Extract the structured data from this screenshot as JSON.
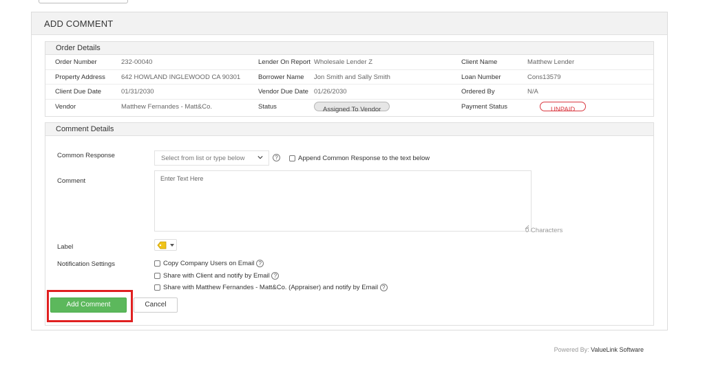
{
  "panel": {
    "title": "ADD COMMENT"
  },
  "order_details": {
    "title": "Order Details",
    "rows": [
      [
        {
          "label": "Order Number",
          "value": "232-00040"
        },
        {
          "label": "Lender On Report",
          "value": "Wholesale Lender Z"
        },
        {
          "label": "Client Name",
          "value": "Matthew Lender"
        }
      ],
      [
        {
          "label": "Property Address",
          "value": "642 HOWLAND INGLEWOOD CA 90301"
        },
        {
          "label": "Borrower Name",
          "value": "Jon Smith and Sally Smith"
        },
        {
          "label": "Loan Number",
          "value": "Cons13579"
        }
      ],
      [
        {
          "label": "Client Due Date",
          "value": "01/31/2030"
        },
        {
          "label": "Vendor Due Date",
          "value": "01/26/2030"
        },
        {
          "label": "Ordered By",
          "value": "N/A"
        }
      ],
      [
        {
          "label": "Vendor",
          "value": "Matthew Fernandes - Matt&Co."
        },
        {
          "label": "Status",
          "value": "Assigned To Vendor"
        },
        {
          "label": "Payment Status",
          "value": "UNPAID"
        }
      ]
    ]
  },
  "comment_details": {
    "title": "Comment Details",
    "common_response_label": "Common Response",
    "common_response_placeholder": "Select from list or type below",
    "append_label": "Append Common Response to the text below",
    "comment_label": "Comment",
    "comment_placeholder": "Enter Text Here",
    "char_count": "0 Characters",
    "label_label": "Label",
    "notification_label": "Notification Settings",
    "notifications": [
      "Copy Company Users on Email",
      "Share with Client and notify by Email",
      "Share with Matthew Fernandes - Matt&Co. (Appraiser) and notify by Email"
    ]
  },
  "buttons": {
    "add": "Add Comment",
    "cancel": "Cancel"
  },
  "footer": {
    "prefix": "Powered By: ",
    "brand": "ValueLink Software"
  },
  "colors": {
    "accent_green": "#5cb85c",
    "unpaid_red": "#d9363e",
    "highlight_red": "#e02020"
  },
  "icons": {
    "dropdown": "chevron-down-icon",
    "help": "help-icon",
    "label": "tag-icon"
  }
}
